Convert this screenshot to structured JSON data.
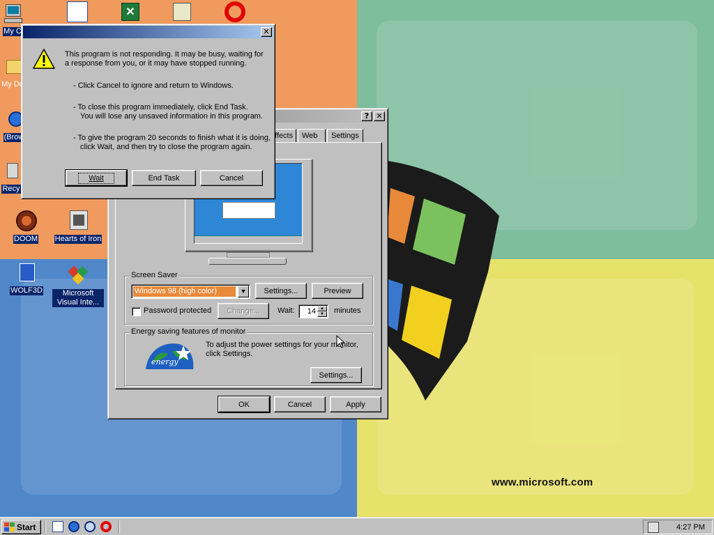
{
  "desktop": {
    "watermark_url": "www.microsoft.com",
    "icons": [
      {
        "label": "My C",
        "icon": "my-computer-icon"
      },
      {
        "label": "My Do",
        "icon": "my-documents-icon"
      },
      {
        "label": "(Brow",
        "icon": "browser-icon"
      },
      {
        "label": "Recy",
        "icon": "recycle-bin-icon"
      },
      {
        "label": "DOOM",
        "icon": "doom-icon"
      },
      {
        "label": "Hearts of Iron",
        "icon": "hearts-of-iron-icon"
      },
      {
        "label": "WOLF3D",
        "icon": "wolf3d-icon"
      },
      {
        "label": "Microsoft Visual Inte...",
        "icon": "visual-interdev-icon"
      }
    ]
  },
  "not_responding_dialog": {
    "message": "This program is not responding. It may be busy, waiting for a response from you, or it may have stopped running.",
    "bullet_cancel": "-  Click Cancel to ignore and return to Windows.",
    "bullet_end_task_1": "-  To close this program immediately, click End Task.",
    "bullet_end_task_2": "You will lose any unsaved information in this program.",
    "bullet_wait_1": "-  To give the program 20 seconds to finish what it is doing,",
    "bullet_wait_2": "click Wait, and then try to close the program again.",
    "buttons": {
      "wait": "Wait",
      "end_task": "End Task",
      "cancel": "Cancel"
    }
  },
  "display_properties": {
    "tabs": {
      "effects": "ffects",
      "web": "Web",
      "settings": "Settings"
    },
    "screen_saver": {
      "group_label": "Screen Saver",
      "selected": "Windows 98 (high color)",
      "settings_button": "Settings...",
      "preview_button": "Preview",
      "password_protected": "Password protected",
      "password_checked": false,
      "change_button": "Change...",
      "wait_label": "Wait:",
      "wait_value": "14",
      "minutes_label": "minutes"
    },
    "energy": {
      "group_label": "Energy saving features of monitor",
      "text": "To adjust the power settings for your monitor, click Settings.",
      "settings_button": "Settings...",
      "logo_text": "energy"
    },
    "buttons": {
      "ok": "OK",
      "cancel": "Cancel",
      "apply": "Apply"
    }
  },
  "taskbar": {
    "start_label": "Start",
    "clock": "4:27 PM"
  },
  "colors": {
    "title_active": "#0a246a",
    "face": "#c0c0c0",
    "select": "#0a246a"
  }
}
